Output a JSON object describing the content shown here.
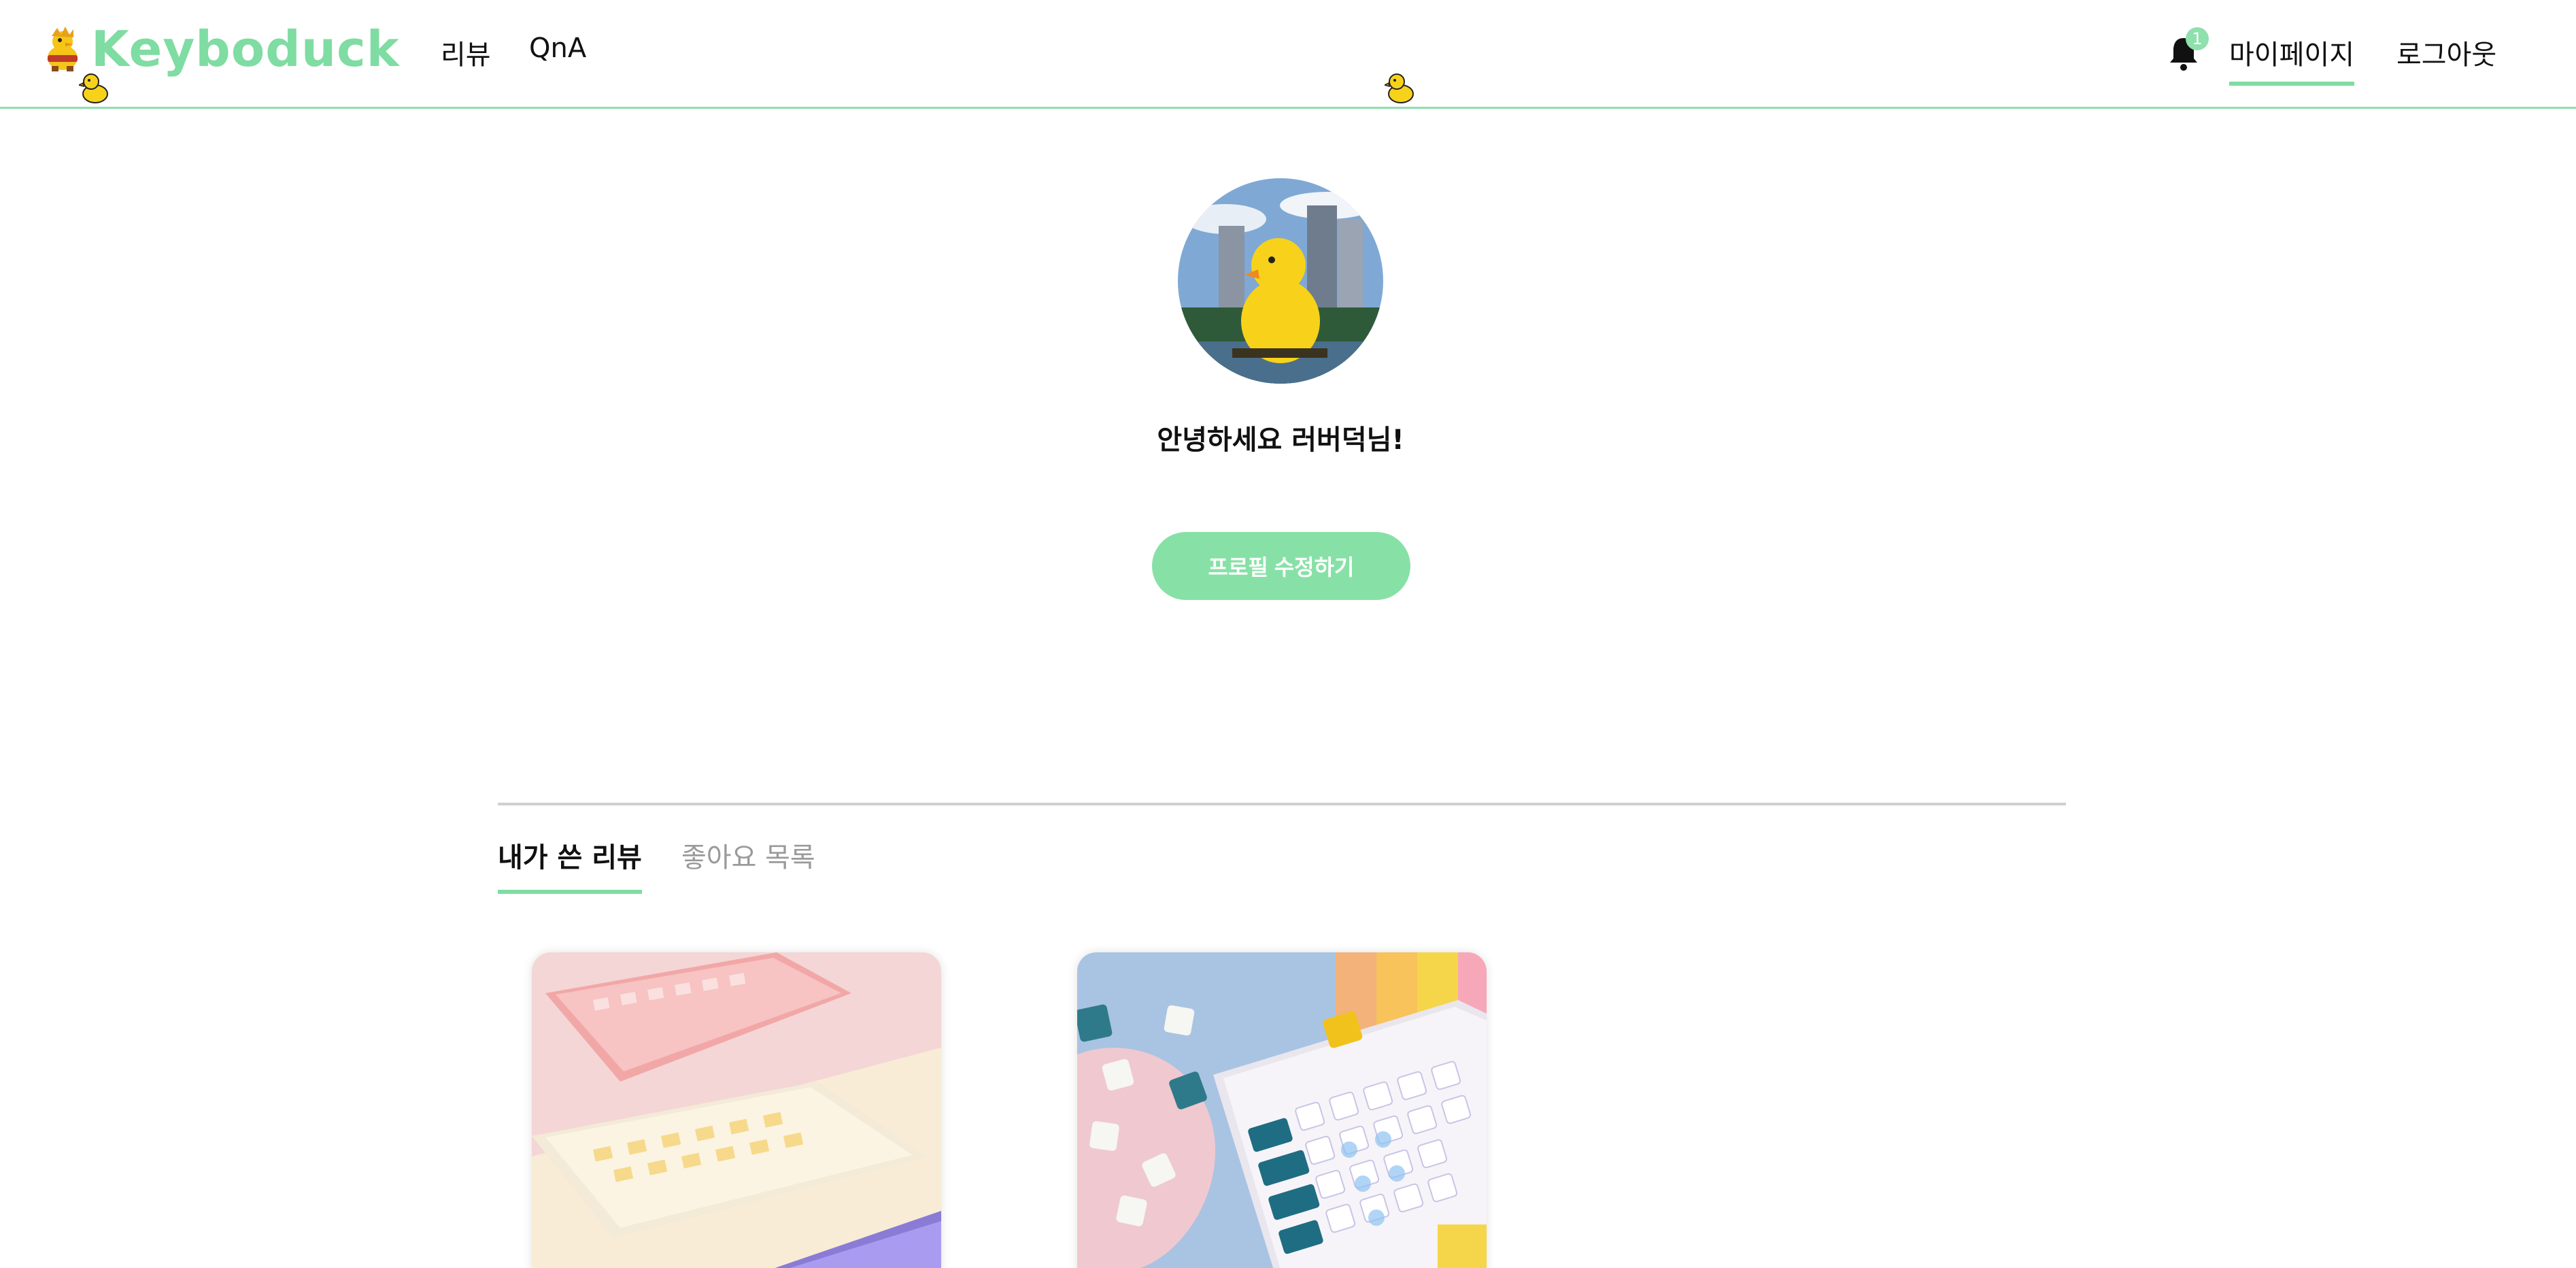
{
  "header": {
    "logo_text": "Keyboduck",
    "nav": {
      "review": "리뷰",
      "qna": "QnA"
    },
    "notification_count": "1",
    "mypage": "마이페이지",
    "logout": "로그아웃"
  },
  "profile": {
    "greeting": "안녕하세요 러버덕님!",
    "edit_button": "프로필 수정하기"
  },
  "tabs": {
    "my_reviews": "내가 쓴 리뷰",
    "likes": "좋아요 목록"
  },
  "cards": [
    {
      "image": "pastel-keyboards-image"
    },
    {
      "image": "rgb-keyboard-with-keycaps-image"
    }
  ],
  "colors": {
    "accent": "#7fdca2",
    "button": "#87e1a6",
    "header_border": "#8fe0ad",
    "inactive_tab": "#9a9a9a"
  },
  "icons": [
    "duck-mascot-icon",
    "duck-icon",
    "bell-icon"
  ]
}
